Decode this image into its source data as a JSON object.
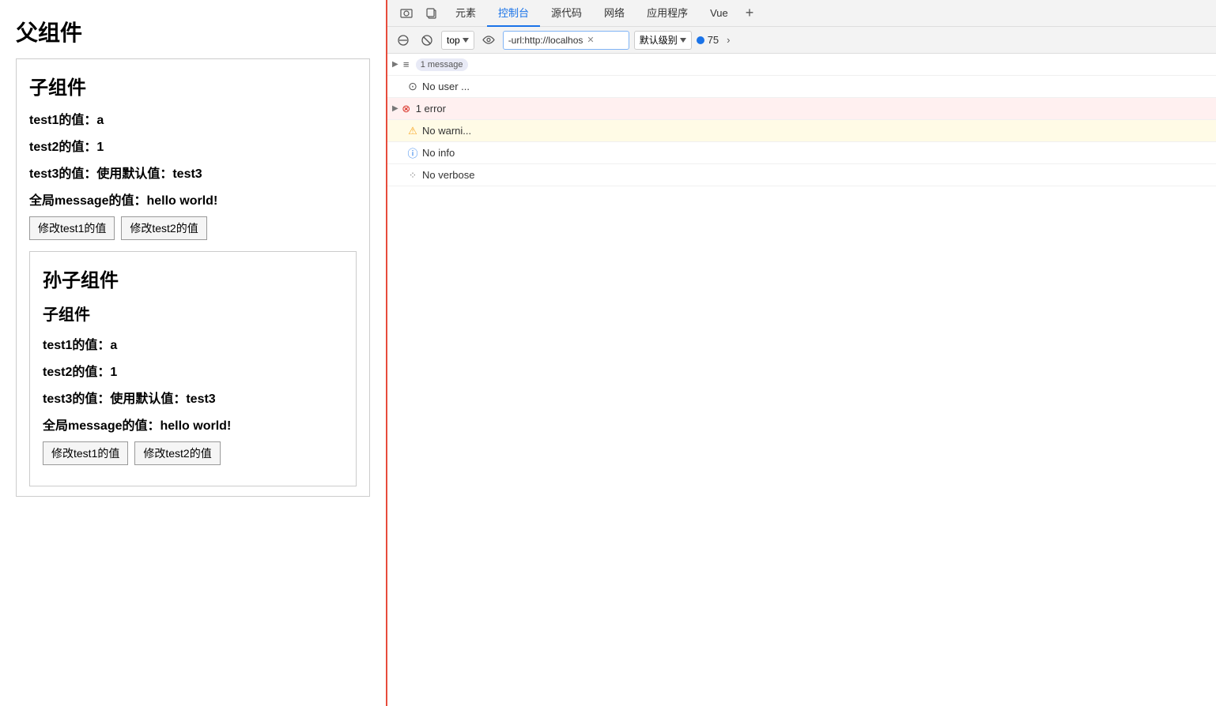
{
  "app": {
    "parent_title": "父组件",
    "child": {
      "section_title": "子组件",
      "test1_label": "test1的值：a",
      "test2_label": "test2的值：1",
      "test3_label": "test3的值：使用默认值：test3",
      "message_label": "全局message的值：hello world!",
      "btn1_label": "修改test1的值",
      "btn2_label": "修改test2的值"
    },
    "grandchild": {
      "section_title": "孙子组件",
      "sub_title": "子组件",
      "test1_label": "test1的值：a",
      "test2_label": "test2的值：1",
      "test3_label": "test3的值：使用默认值：test3",
      "message_label": "全局message的值：hello world!",
      "btn1_label": "修改test1的值",
      "btn2_label": "修改test2的值"
    }
  },
  "devtools": {
    "tabs": [
      {
        "label": "元素",
        "active": false
      },
      {
        "label": "控制台",
        "active": true
      },
      {
        "label": "源代码",
        "active": false
      },
      {
        "label": "网络",
        "active": false
      },
      {
        "label": "应用程序",
        "active": false
      },
      {
        "label": "Vue",
        "active": false
      }
    ],
    "toolbar": {
      "top_label": "top",
      "url_value": "-url:http://localhos",
      "level_label": "默认级别",
      "badge_count": "75"
    },
    "console": {
      "rows": [
        {
          "type": "message",
          "toggle": true,
          "count": "1 message",
          "text": ""
        },
        {
          "type": "user",
          "toggle": false,
          "icon": "user",
          "text": "No user ..."
        },
        {
          "type": "error",
          "toggle": true,
          "icon": "error",
          "count_text": "1 error",
          "text": ""
        },
        {
          "type": "warning",
          "toggle": false,
          "icon": "warning",
          "text": "No warni..."
        },
        {
          "type": "info",
          "toggle": false,
          "icon": "info",
          "text": "No info"
        },
        {
          "type": "verbose",
          "toggle": false,
          "icon": "verbose",
          "text": "No verbose"
        }
      ]
    }
  }
}
